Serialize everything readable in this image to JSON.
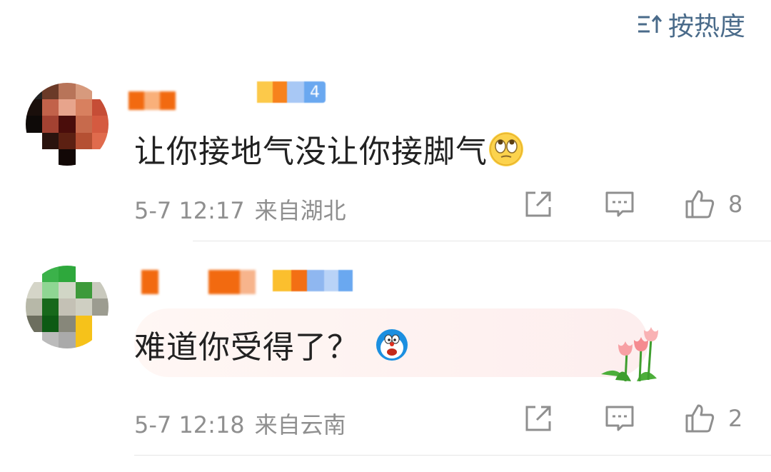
{
  "sort": {
    "label": "按热度"
  },
  "comments": [
    {
      "text": "让你接地气没让你接脚气",
      "badge_num": "4",
      "time": "5-7 12:17",
      "location": "来自湖北",
      "likes": "8",
      "emoji": "rolling-eyes-emoji"
    },
    {
      "text": "难道你受得了？",
      "badge_num": "",
      "time": "5-7 12:18",
      "location": "来自云南",
      "likes": "2",
      "emoji": "doraemon-emoji"
    }
  ],
  "colors": {
    "accent_blue": "#4a6b8a",
    "meta_gray": "#8f8f8f",
    "name_orange": "#f7731a",
    "badge_blue": "#6aa8f0"
  }
}
